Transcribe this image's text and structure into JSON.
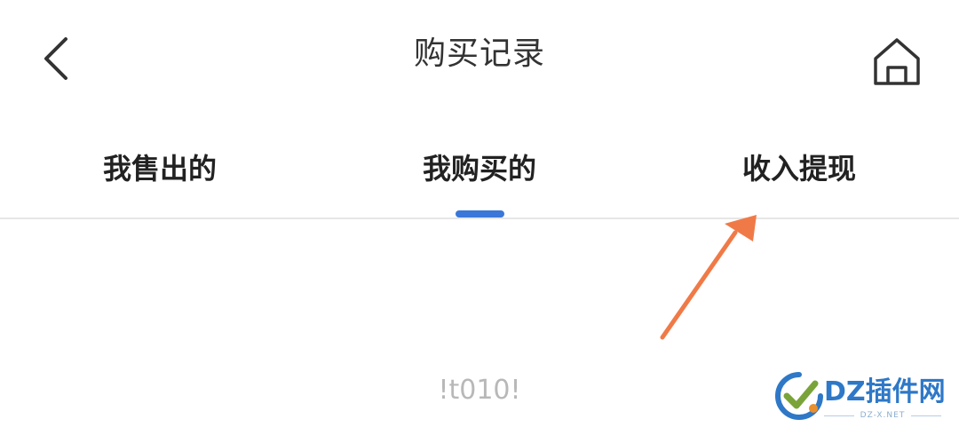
{
  "header": {
    "title": "购买记录",
    "back_icon": "chevron-left-icon",
    "home_icon": "home-icon"
  },
  "tabs": [
    {
      "label": "我售出的",
      "active": false
    },
    {
      "label": "我购买的",
      "active": true
    },
    {
      "label": "收入提现",
      "active": false
    }
  ],
  "colors": {
    "accent": "#3a77d8",
    "annotation_arrow": "#f07a47",
    "placeholder_text": "#b8b8b8"
  },
  "content": {
    "empty_text": "!t010!"
  },
  "watermark": {
    "text": "DZ插件网",
    "subtext": "DZ-X.NET"
  }
}
